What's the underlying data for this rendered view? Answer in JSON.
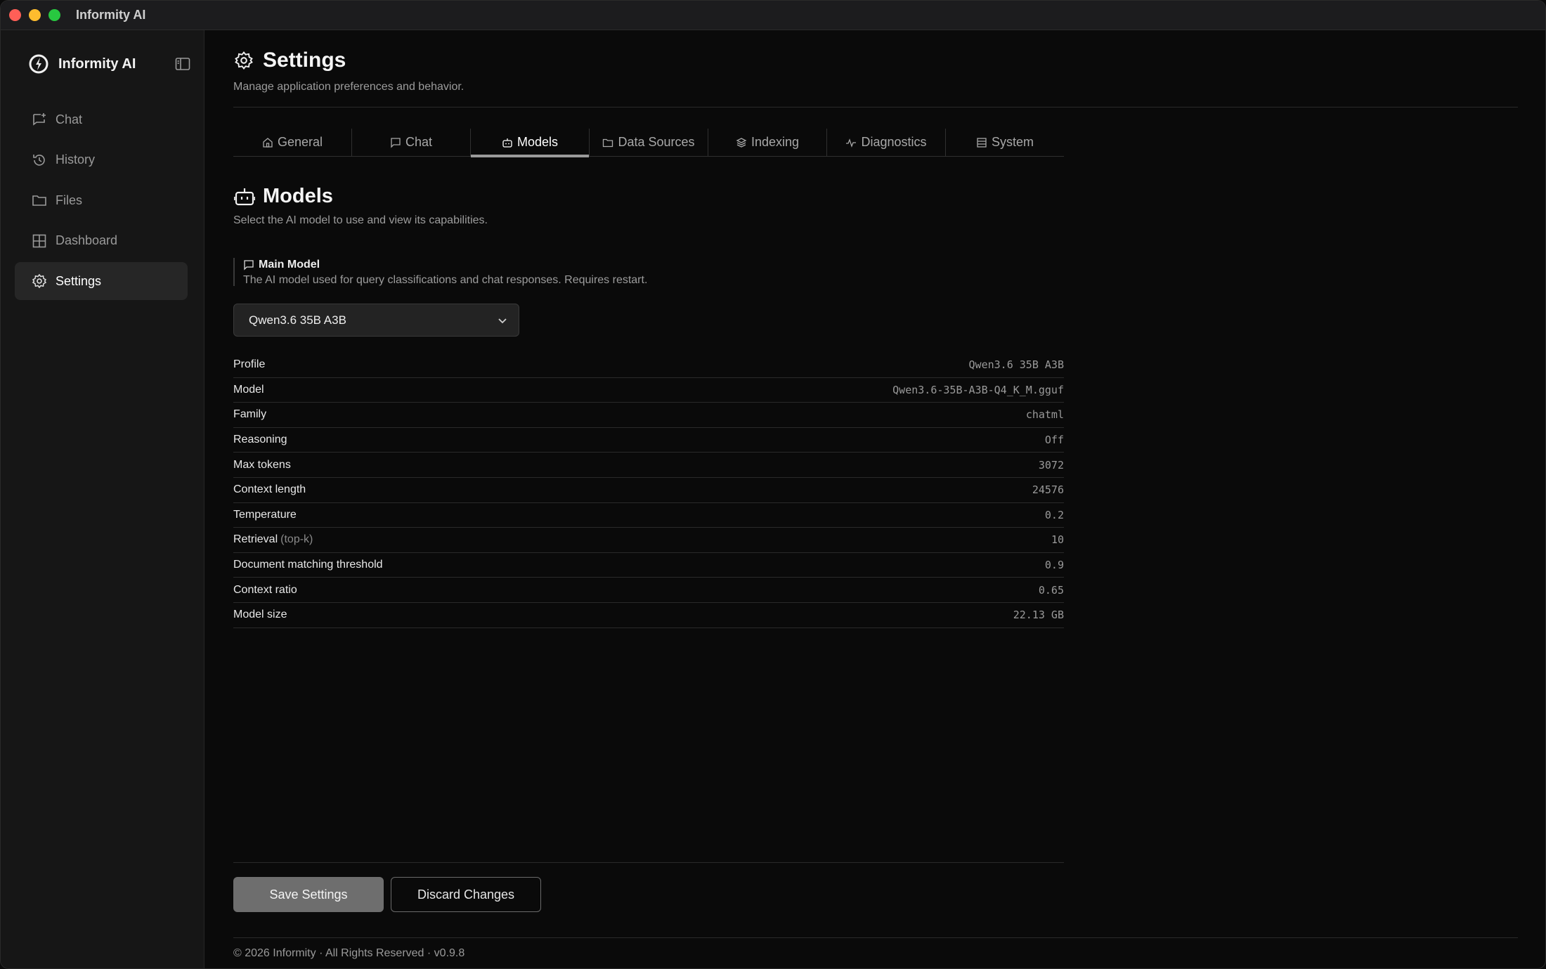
{
  "window": {
    "title": "Informity AI"
  },
  "sidebar": {
    "brand": "Informity AI",
    "items": [
      {
        "label": "Chat",
        "icon": "chat-plus-icon"
      },
      {
        "label": "History",
        "icon": "history-icon"
      },
      {
        "label": "Files",
        "icon": "folder-icon"
      },
      {
        "label": "Dashboard",
        "icon": "grid-icon"
      },
      {
        "label": "Settings",
        "icon": "gear-icon",
        "active": true
      }
    ]
  },
  "page": {
    "title": "Settings",
    "subtitle": "Manage application preferences and behavior."
  },
  "tabs": [
    {
      "label": "General",
      "icon": "home-icon"
    },
    {
      "label": "Chat",
      "icon": "chat-icon"
    },
    {
      "label": "Models",
      "icon": "robot-icon",
      "active": true
    },
    {
      "label": "Data Sources",
      "icon": "folder-icon"
    },
    {
      "label": "Indexing",
      "icon": "layers-icon"
    },
    {
      "label": "Diagnostics",
      "icon": "activity-icon"
    },
    {
      "label": "System",
      "icon": "server-icon"
    }
  ],
  "section": {
    "title": "Models",
    "subtitle": "Select the AI model to use and view its capabilities."
  },
  "main_model": {
    "label": "Main Model",
    "help": "The AI model used for query classifications and chat responses. Requires restart.",
    "selected": "Qwen3.6 35B A3B"
  },
  "properties": [
    {
      "key": "Profile",
      "value": "Qwen3.6 35B A3B"
    },
    {
      "key": "Model",
      "value": "Qwen3.6-35B-A3B-Q4_K_M.gguf"
    },
    {
      "key": "Family",
      "value": "chatml"
    },
    {
      "key": "Reasoning",
      "value": "Off"
    },
    {
      "key": "Max tokens",
      "value": "3072"
    },
    {
      "key": "Context length",
      "value": "24576"
    },
    {
      "key": "Temperature",
      "value": "0.2"
    },
    {
      "key": "Retrieval",
      "key_note": "(top-k)",
      "value": "10"
    },
    {
      "key": "Document matching threshold",
      "value": "0.9"
    },
    {
      "key": "Context ratio",
      "value": "0.65"
    },
    {
      "key": "Model size",
      "value": "22.13 GB"
    }
  ],
  "actions": {
    "save": "Save Settings",
    "discard": "Discard Changes"
  },
  "footer": "© 2026 Informity · All Rights Reserved · v0.9.8",
  "colors": {
    "background": "#0a0a0a",
    "sidebar": "#161616",
    "active_item": "#262626",
    "save_button": "#6e6e6e"
  }
}
